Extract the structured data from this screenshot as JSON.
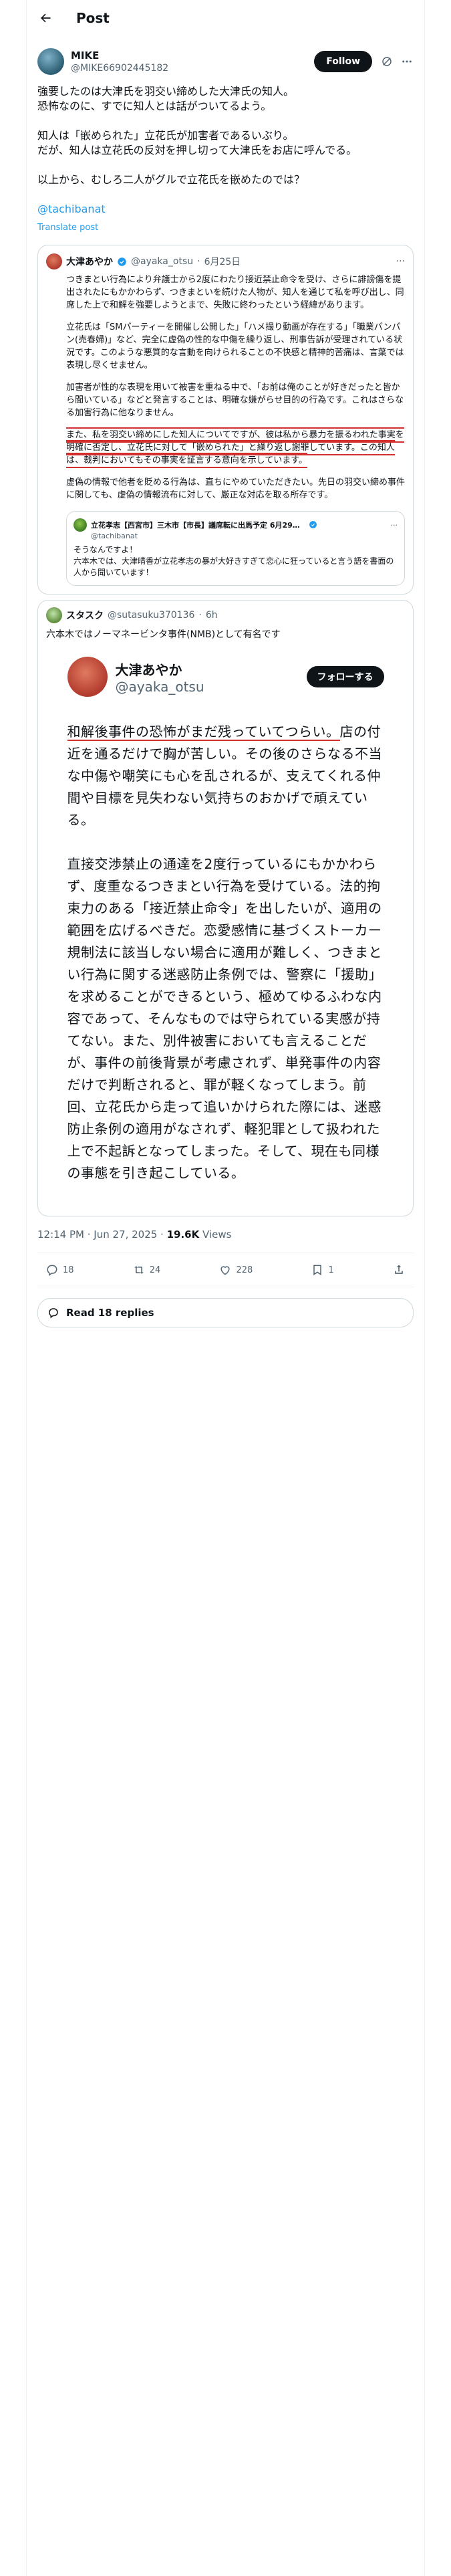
{
  "header": {
    "title": "Post"
  },
  "author": {
    "name": "MIKE",
    "handle": "@MIKE66902445182",
    "follow_label": "Follow"
  },
  "post": {
    "lines": [
      "強要したのは大津氏を羽交い締めした大津氏の知人。",
      "恐怖なのに、すでに知人とは話がついてるよう。",
      "",
      "知人は「嵌められた」立花氏が加害者であるいぶり。",
      "だが、知人は立花氏の反対を押し切って大津氏をお店に呼んでる。",
      "",
      "以上から、むしろ二人がグルで立花氏を嵌めたのでは？"
    ],
    "mention": "@tachibanat",
    "translate": "Translate post"
  },
  "quote": {
    "name": "大津あやか",
    "handle": "@ayaka_otsu",
    "date": "6月25日",
    "paragraphs": [
      "つきまとい行為により弁護士から2度にわたり接近禁止命令を受け、さらに誹謗傷を提出されたにもかかわらず、つきまといを続けた人物が、知人を通じて私を呼び出し、同席した上で和解を強要しようとまで、失敗に終わったという経緯があります。",
      "立花氏は「SMパーティーを開催し公開した」「ハメ撮り動画が存在する」「職業パンパン(売春婦)」など、完全に虚偽の性的な中傷を繰り返し、刑事告訴が受理されている状況です。このような悪質的な言動を向けられることの不快感と精神的苦痛は、言葉では表現し尽くせません。",
      "加害者が性的な表現を用いて被害を重ねる中で、「お前は俺のことが好きだったと皆から聞いている」などと発言することは、明確な嫌がらせ目的の行為です。これはさらなる加害行為に他なりません。"
    ],
    "highlight": "また、私を羽交い締めにした知人についてですが、彼は私から暴力を振るわれた事実を明確に否定し、立花氏に対して「嵌められた」と繰り返し謝罪しています。この知人は、裁判においてもその事実を証言する意向を示しています。",
    "closing": "虚偽の情報で他者を貶める行為は、直ちにやめていただきたい。先日の羽交い締め事件に関しても、虚偽の情報流布に対して、厳正な対応を取る所存です。"
  },
  "inner_quote": {
    "name": "立花孝志【西宮市】三木市【市長】議席転に出馬予定 6月29日投票…",
    "handle": "@tachibanat",
    "line1": "そうなんですよ！",
    "line2": "六本木では、大津晴香が立花孝志の暴が大好きすぎて恋心に狂っていると言う語を書面の人から聞いています！"
  },
  "card2": {
    "name": "スタスク",
    "handle": "@sutasuku370136",
    "time": "6h",
    "text": "六本木ではノーマネービンタ事件(NMB)として有名です"
  },
  "shot": {
    "name": "大津あやか",
    "handle": "@ayaka_otsu",
    "follow_label": "フォローする",
    "para1_ul": "和解後事件の恐怖がまだ残っていてつらい。",
    "para1_rest": "店の付近を通るだけで胸が苦しい。その後のさらなる不当な中傷や嘲笑にも心を乱されるが、支えてくれる仲間や目標を見失わない気持ちのおかげで頑えている。",
    "para2": "直接交渉禁止の通達を2度行っているにもかかわらず、度重なるつきまとい行為を受けている。法的拘束力のある「接近禁止命令」を出したいが、適用の範囲を広げるべきだ。恋愛感情に基づくストーカー規制法に該当しない場合に適用が難しく、つきまとい行為に関する迷惑防止条例では、警察に「援助」を求めることができるという、極めてゆるふわな内容であって、そんなものでは守られている実感が持てない。また、別件被害においても言えることだが、事件の前後背景が考慮されず、単発事件の内容だけで判断されると、罪が軽くなってしまう。前回、立花氏から走って追いかけられた際には、迷惑防止条例の適用がなされず、軽犯罪として扱われた上で不起訴となってしまった。そして、現在も同様の事態を引き起こしている。"
  },
  "meta": {
    "time": "12:14 PM · Jun 27, 2025 · ",
    "views": "19.6K",
    "views_label": " Views"
  },
  "actions": {
    "replies": "18",
    "reposts": "24",
    "likes": "228",
    "bookmarks": "1"
  },
  "replies_button": "Read 18 replies"
}
